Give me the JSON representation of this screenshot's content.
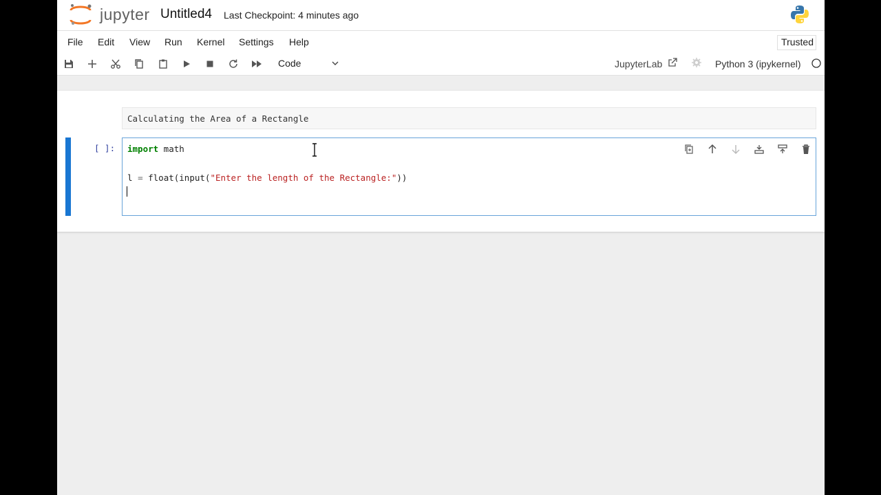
{
  "header": {
    "logo_text": "jupyter",
    "notebook_title": "Untitled4",
    "checkpoint": "Last Checkpoint: 4 minutes ago"
  },
  "menubar": {
    "items": [
      "File",
      "Edit",
      "View",
      "Run",
      "Kernel",
      "Settings",
      "Help"
    ],
    "trusted_label": "Trusted"
  },
  "toolbar": {
    "cell_type": "Code",
    "jupyterlab_link": "JupyterLab",
    "kernel": "Python 3 (ipykernel)",
    "icons": [
      "save-icon",
      "add-icon",
      "cut-icon",
      "copy-icon",
      "paste-icon",
      "run-icon",
      "stop-icon",
      "restart-icon",
      "fast-forward-icon"
    ]
  },
  "cells": {
    "markdown": "Calculating the Area of a Rectangle",
    "code": {
      "prompt": "[ ]:",
      "line1_kw": "import",
      "line1_rest": " math",
      "line3_prefix": "l ",
      "line3_eq": "=",
      "line3_call": " float(input(",
      "line3_str": "\"Enter the length of the Rectangle:\"",
      "line3_end": "))"
    }
  },
  "colors": {
    "accent": "#1976d2",
    "keyword": "#008000",
    "string": "#ba2121",
    "logo_orange": "#f37726"
  }
}
